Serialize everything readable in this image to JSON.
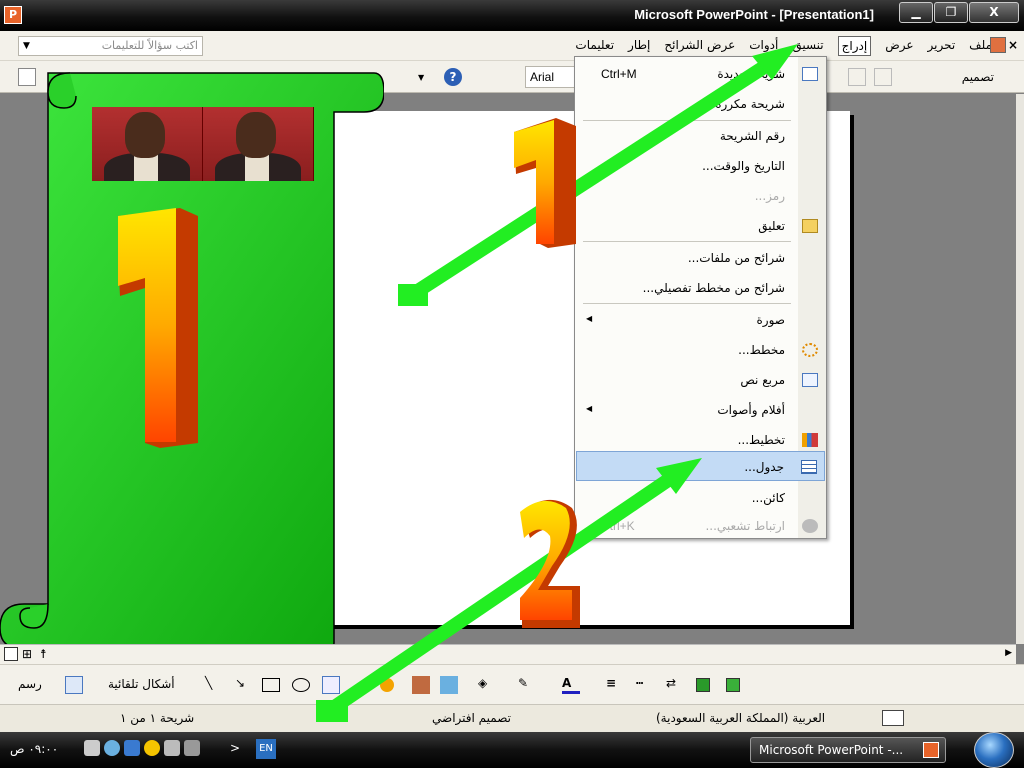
{
  "window": {
    "title": "Microsoft PowerPoint - [Presentation1]",
    "minimize": "▁",
    "restore": "❐",
    "close": "X"
  },
  "menubar": {
    "close_doc": "×",
    "items": [
      "ملف",
      "تحرير",
      "عرض",
      "إدراج",
      "تنسيق",
      "أدوات",
      "عرض الشرائح",
      "إطار",
      "تعليمات"
    ],
    "help_placeholder": "اكتب سؤالاً للتعليمات"
  },
  "toolbar": {
    "font_name": "Arial",
    "design_label": "تصميم"
  },
  "insert_menu": {
    "items": [
      {
        "label": "شريحة جديدة",
        "shortcut": "Ctrl+M",
        "enabled": true,
        "icon": "new-slide-icon"
      },
      {
        "label": "شريحة مكررة",
        "shortcut": "",
        "enabled": true,
        "icon": ""
      },
      {
        "label": "رقم الشريحة",
        "shortcut": "",
        "enabled": true,
        "icon": ""
      },
      {
        "label": "التاريخ والوقت...",
        "shortcut": "",
        "enabled": true,
        "icon": ""
      },
      {
        "label": "رمز...",
        "shortcut": "",
        "enabled": false,
        "icon": ""
      },
      {
        "label": "تعليق",
        "shortcut": "",
        "enabled": true,
        "icon": "comment-icon"
      },
      {
        "label": "شرائح من ملفات...",
        "shortcut": "",
        "enabled": true,
        "icon": ""
      },
      {
        "label": "شرائح من مخطط تفصيلي...",
        "shortcut": "",
        "enabled": true,
        "icon": ""
      },
      {
        "label": "صورة",
        "shortcut": "",
        "enabled": true,
        "icon": "",
        "submenu": true
      },
      {
        "label": "مخطط...",
        "shortcut": "",
        "enabled": true,
        "icon": "diagram-icon"
      },
      {
        "label": "مربع نص",
        "shortcut": "",
        "enabled": true,
        "icon": "textbox-icon"
      },
      {
        "label": "أفلام وأصوات",
        "shortcut": "",
        "enabled": true,
        "icon": "",
        "submenu": true
      },
      {
        "label": "تخطيط...",
        "shortcut": "",
        "enabled": true,
        "icon": "chart-icon"
      },
      {
        "label": "جدول...",
        "shortcut": "",
        "enabled": true,
        "icon": "table-icon",
        "highlighted": true
      },
      {
        "label": "كائن...",
        "shortcut": "",
        "enabled": true,
        "icon": ""
      },
      {
        "label": "ارتباط تشعبي...",
        "shortcut": "Ctrl+K",
        "enabled": false,
        "icon": "hyperlink-icon"
      }
    ]
  },
  "slide_overlay": {
    "number_1": "1",
    "number_2": "2"
  },
  "drawbar": {
    "draw_label": "رسم",
    "autoshapes_label": "أشكال تلقائية"
  },
  "statusbar": {
    "slide_pos": "شريحة ١ من ١",
    "design_name": "تصميم افتراضي",
    "language": "العربية (المملكة العربية السعودية)"
  },
  "taskbar": {
    "app_button": "Microsoft PowerPoint -...",
    "lang": "EN",
    "clock": "٠٩:٠٠ ص"
  },
  "colors": {
    "green": "#22dd22",
    "highlight": "#c3dbf5"
  }
}
